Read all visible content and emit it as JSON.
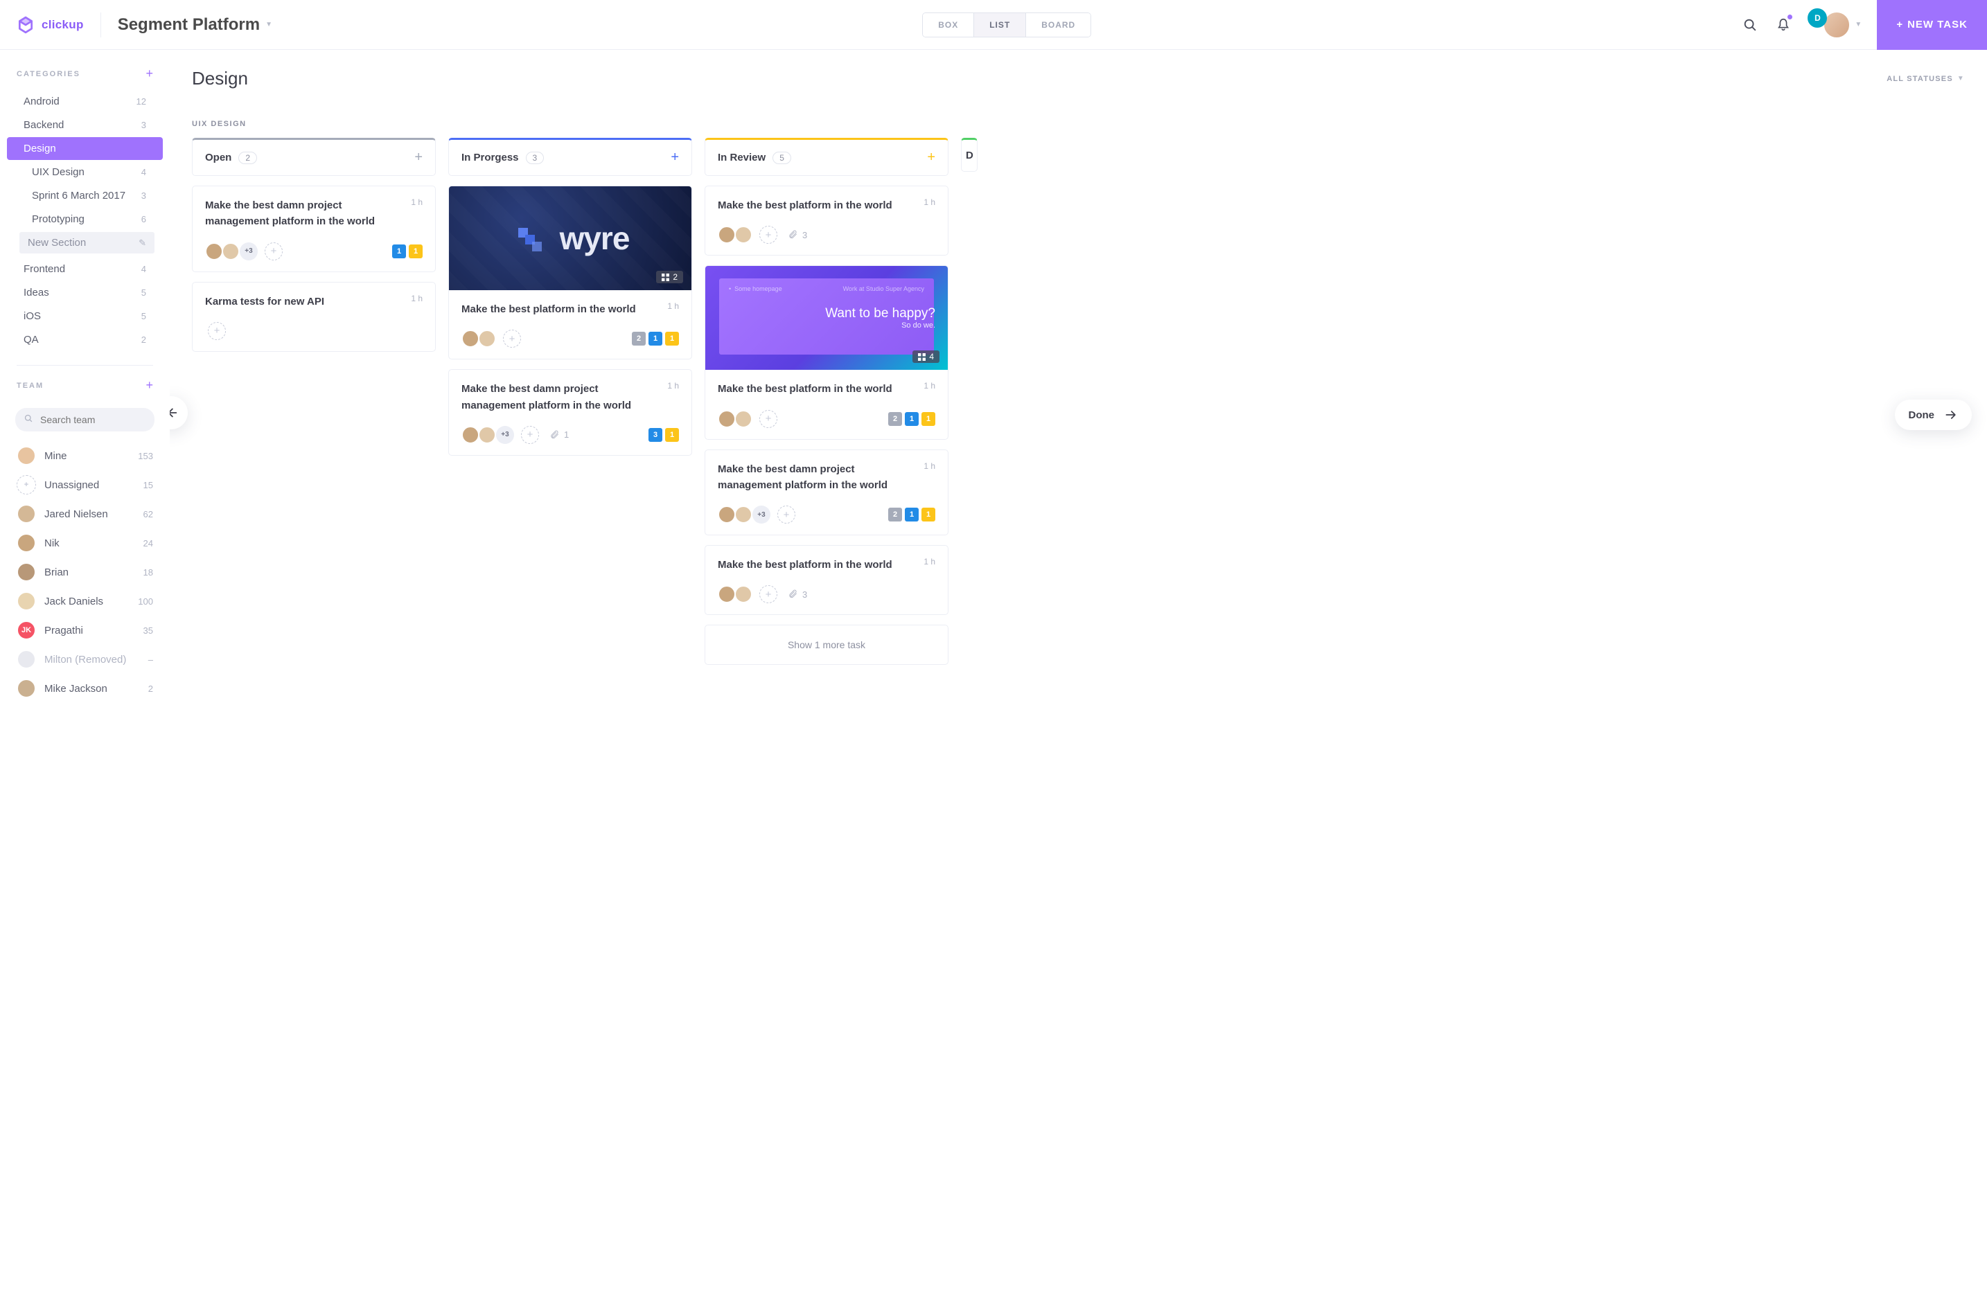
{
  "header": {
    "logo_text": "clickup",
    "space_title": "Segment Platform",
    "views": {
      "box": "BOX",
      "list": "LIST",
      "board": "BOARD"
    },
    "avatar_letter": "D",
    "new_task": "NEW TASK"
  },
  "sidebar": {
    "categories_label": "CATEGORIES",
    "team_label": "TEAM",
    "search_placeholder": "Search team",
    "categories": [
      {
        "label": "Android",
        "count": "12"
      },
      {
        "label": "Backend",
        "count": "3"
      },
      {
        "label": "Design",
        "count": "",
        "active": true
      },
      {
        "label": "UIX Design",
        "count": "4",
        "sub": true
      },
      {
        "label": "Sprint 6 March 2017",
        "count": "3",
        "sub": true
      },
      {
        "label": "Prototyping",
        "count": "6",
        "sub": true
      },
      {
        "label": "New Section",
        "count": "",
        "newsec": true
      },
      {
        "label": "Frontend",
        "count": "4"
      },
      {
        "label": "Ideas",
        "count": "5"
      },
      {
        "label": "iOS",
        "count": "5"
      },
      {
        "label": "QA",
        "count": "2"
      }
    ],
    "team": [
      {
        "name": "Mine",
        "count": "153",
        "av": "photo1"
      },
      {
        "name": "Unassigned",
        "count": "15",
        "av": "unassigned"
      },
      {
        "name": "Jared Nielsen",
        "count": "62",
        "av": "photo2"
      },
      {
        "name": "Nik",
        "count": "24",
        "av": "photo3"
      },
      {
        "name": "Brian",
        "count": "18",
        "av": "photo4"
      },
      {
        "name": "Jack Daniels",
        "count": "100",
        "av": "photo5"
      },
      {
        "name": "Pragathi",
        "count": "35",
        "av": "jk",
        "initials": "JK"
      },
      {
        "name": "Milton (Removed)",
        "count": "–",
        "av": "removed"
      },
      {
        "name": "Mike Jackson",
        "count": "2",
        "av": "photo6"
      }
    ]
  },
  "content": {
    "title": "Design",
    "status_filter": "ALL STATUSES",
    "section": "UIX DESIGN",
    "show_more": "Show 1 more task",
    "done_label": "Done"
  },
  "columns": [
    {
      "title": "Open",
      "count": "2",
      "color": "gray",
      "cards": [
        {
          "title": "Make the best damn project management platform in the world",
          "time": "1 h",
          "avatars": 2,
          "plus": "+3",
          "tags": [
            "blue",
            "yellow"
          ]
        },
        {
          "title": "Karma tests for new API",
          "time": "1 h",
          "avatars": 0,
          "tags": []
        }
      ]
    },
    {
      "title": "In Prorgess",
      "count": "3",
      "color": "blue",
      "cards": [
        {
          "image": "wyre",
          "imgcount": "2",
          "title": "Make the best platform in the world",
          "time": "1 h",
          "avatars": 2,
          "tags": [
            "gray",
            "blue",
            "yellow"
          ]
        },
        {
          "title": "Make the best damn project management platform in the world",
          "time": "1 h",
          "avatars": 2,
          "plus": "+3",
          "attach": "1",
          "tags": [
            "blue",
            "yellow"
          ]
        }
      ]
    },
    {
      "title": "In Review",
      "count": "5",
      "color": "yellow",
      "cards": [
        {
          "title": "Make the best platform in the world",
          "time": "1 h",
          "avatars": 2,
          "attach": "3",
          "tags": []
        },
        {
          "image": "grad",
          "imgcount": "4",
          "happy1": "Want to be happy?",
          "happy2": "So do we.",
          "title": "Make the best platform in the world",
          "time": "1 h",
          "avatars": 2,
          "tags": [
            "gray",
            "blue",
            "yellow"
          ]
        },
        {
          "title": "Make the best damn project management platform in the world",
          "time": "1 h",
          "avatars": 2,
          "plus": "+3",
          "tags": [
            "gray",
            "blue",
            "yellow"
          ]
        },
        {
          "title": "Make the best platform in the world",
          "time": "1 h",
          "avatars": 2,
          "attach": "3",
          "tags": []
        }
      ]
    }
  ]
}
